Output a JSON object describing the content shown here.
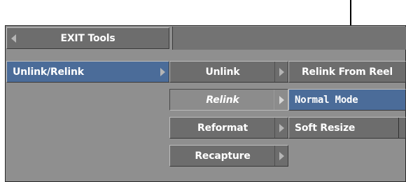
{
  "header": {
    "exit_tools_label": "EXIT Tools"
  },
  "column1": {
    "unlink_relink_label": "Unlink/Relink"
  },
  "column2": {
    "unlink_label": "Unlink",
    "relink_label": "Relink",
    "reformat_label": "Reformat",
    "recapture_label": "Recapture"
  },
  "column3": {
    "relink_from_reel_label": "Relink From Reel",
    "normal_mode_label": "Normal Mode",
    "soft_resize_label": "Soft Resize"
  },
  "colors": {
    "panel": "#8f8f8f",
    "button_gray": "#6d6d6d",
    "button_blue": "#4b6c99",
    "pressed": "#8c8c8c"
  }
}
